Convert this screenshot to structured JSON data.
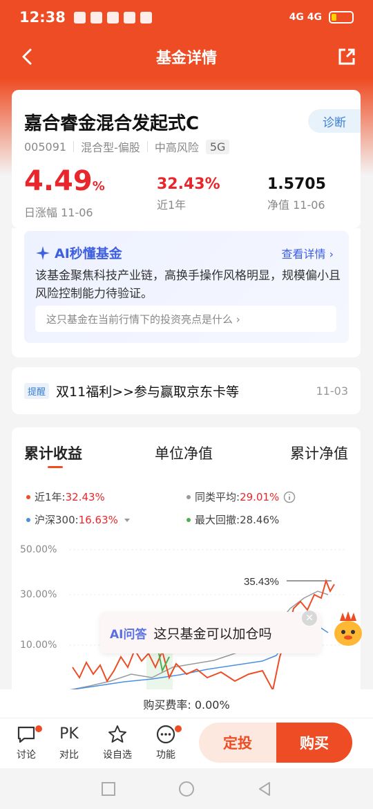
{
  "status": {
    "time": "12:38",
    "network": "4G 4G"
  },
  "header": {
    "title": "基金详情"
  },
  "fund": {
    "name": "嘉合睿金混合发起式C",
    "diagnose": "诊断",
    "code": "005091",
    "type": "混合型-偏股",
    "risk": "中高风险",
    "badge": "5G",
    "daily_change": "4.49",
    "daily_unit": "%",
    "daily_label": "日涨幅 11-06",
    "year_return": "32.43%",
    "year_label": "近1年",
    "nav": "1.5705",
    "nav_label": "净值 11-06"
  },
  "ai_card": {
    "title": "AI秒懂基金",
    "more": "查看详情 ›",
    "desc": "该基金聚焦科技产业链，高换手操作风格明显，规模偏小且风险控制能力待验证。",
    "question": "这只基金在当前行情下的投资亮点是什么 ›"
  },
  "notice": {
    "tag": "提醒",
    "text": "双11福利>>参与赢取京东卡等",
    "date": "11-03"
  },
  "chart_tabs": [
    "累计收益",
    "单位净值",
    "累计净值"
  ],
  "legend": {
    "l1_label": "近1年:",
    "l1_value": "32.43%",
    "l2_label": "同类平均:",
    "l2_value": "29.01%",
    "l3_label": "沪深300:",
    "l3_value": "16.63%",
    "l4_label": "最大回撤:",
    "l4_value": "28.46%"
  },
  "chart_data": {
    "type": "line",
    "yticks": [
      "50.00%",
      "30.00%",
      "10.00%"
    ],
    "annotation": "35.43%",
    "series": [
      {
        "name": "近1年",
        "color": "#ee4c24"
      },
      {
        "name": "同类平均",
        "color": "#999999"
      },
      {
        "name": "沪深300",
        "color": "#4a8fe0"
      }
    ]
  },
  "ai_bubble": {
    "label": "AI问答",
    "text": "这只基金可以加仓吗"
  },
  "fee": {
    "text": "购买费率: 0.00%"
  },
  "bottom": {
    "discuss": "讨论",
    "compare_icon": "PK",
    "compare": "对比",
    "watch": "设自选",
    "func": "功能",
    "plan": "定投",
    "buy": "购买"
  },
  "colors": {
    "brand": "#ee4c24",
    "up": "#e8262b",
    "ai": "#3d5fe0"
  }
}
